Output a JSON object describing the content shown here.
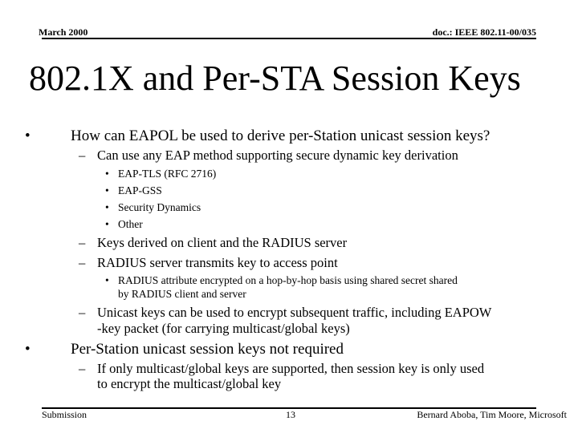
{
  "header": {
    "date": "March 2000",
    "doc_id": "doc.: IEEE 802.11-00/035"
  },
  "title": "802.1X and Per-STA Session Keys",
  "bullets": {
    "b1": {
      "marker": "•",
      "text": "How can EAPOL be used to derive per-Station unicast session keys?",
      "sub1": {
        "marker": "–",
        "text": "Can use any EAP method supporting secure dynamic key derivation",
        "items": [
          {
            "marker": "•",
            "text": "EAP-TLS (RFC 2716)"
          },
          {
            "marker": "•",
            "text": "EAP-GSS"
          },
          {
            "marker": "•",
            "text": "Security Dynamics"
          },
          {
            "marker": "•",
            "text": "Other"
          }
        ]
      },
      "sub2": {
        "marker": "–",
        "text": "Keys derived on client and the RADIUS server"
      },
      "sub3": {
        "marker": "–",
        "text": "RADIUS server transmits key to access point",
        "items": [
          {
            "marker": "•",
            "line1": "RADIUS attribute encrypted on a hop-by-hop basis using shared secret shared",
            "line2": "by RADIUS client and server"
          }
        ]
      },
      "sub4": {
        "marker": "–",
        "line1": "Unicast keys can be used to encrypt subsequent traffic, including EAPOW",
        "line2": "-key packet (for carrying multicast/global keys)"
      }
    },
    "b2": {
      "marker": "•",
      "text": "Per-Station unicast session keys not required",
      "sub1": {
        "marker": "–",
        "line1": "If only multicast/global keys are supported, then session key is only used",
        "line2": "to encrypt the multicast/global key"
      }
    }
  },
  "footer": {
    "left": "Submission",
    "page": "13",
    "authors": "Bernard Aboba, Tim Moore, Microsoft"
  }
}
